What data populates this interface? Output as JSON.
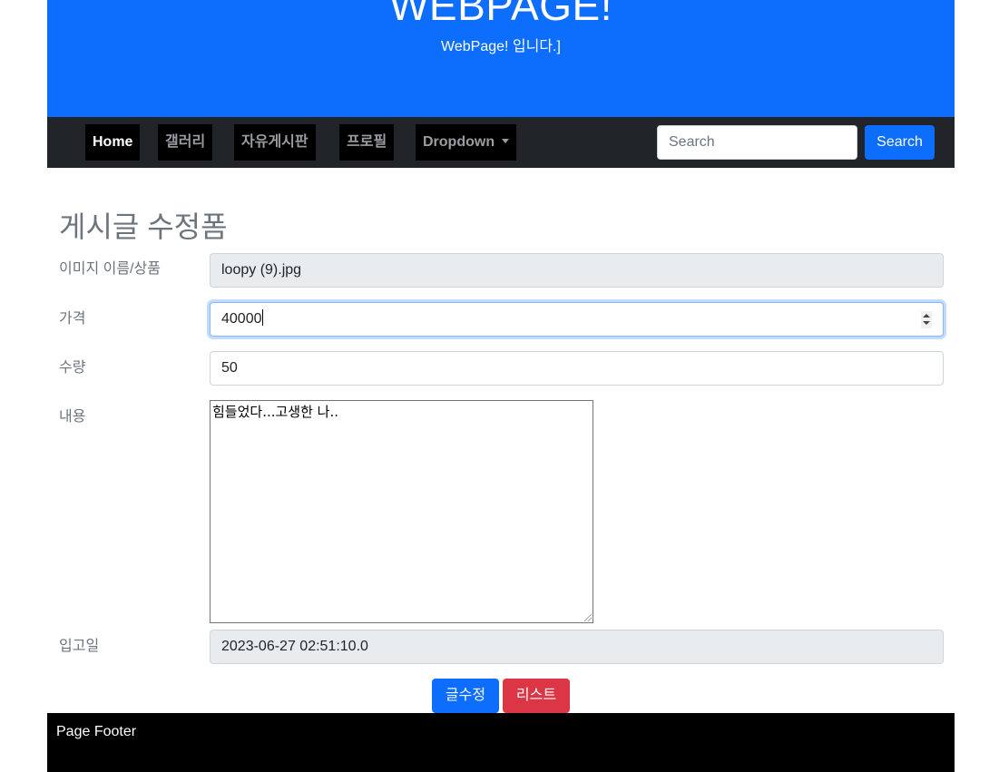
{
  "header": {
    "title": "WEBPAGE!",
    "subtitle": "WebPage! 입니다.]"
  },
  "navbar": {
    "items": [
      {
        "label": "Home",
        "active": true
      },
      {
        "label": "갤러리"
      },
      {
        "label": "자유게시판"
      },
      {
        "label": "프로필"
      },
      {
        "label": "Dropdown",
        "dropdown": true
      }
    ],
    "search_placeholder": "Search",
    "search_button": "Search"
  },
  "form": {
    "title": "게시글 수정폼",
    "fields": {
      "image_name": {
        "label": "이미지 이름/상품",
        "value": "loopy (9).jpg"
      },
      "price": {
        "label": "가격",
        "value": "40000"
      },
      "quantity": {
        "label": "수량",
        "value": "50"
      },
      "content": {
        "label": "내용",
        "value": "힘들었다...고생한 나.."
      },
      "stock_date": {
        "label": "입고일",
        "value": "2023-06-27 02:51:10.0"
      }
    },
    "buttons": {
      "edit": "글수정",
      "list": "리스트"
    }
  },
  "footer": {
    "text": "Page Footer"
  },
  "colors": {
    "primary": "#0d6efd",
    "danger": "#dc3545",
    "navbar": "#212529",
    "footer": "#000000"
  }
}
